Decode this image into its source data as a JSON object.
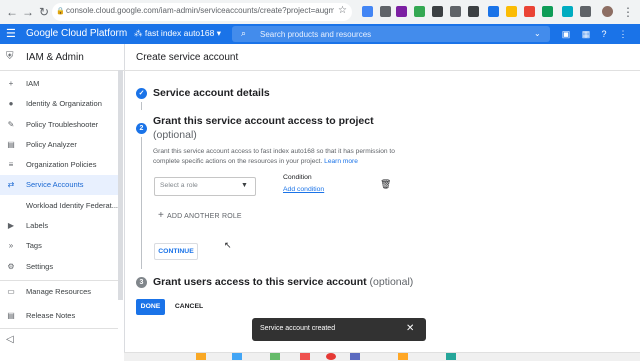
{
  "browser": {
    "url": "console.cloud.google.com/iam-admin/serviceaccounts/create?project=augmented-..."
  },
  "header": {
    "brand": "Google Cloud Platform",
    "project": "fast index auto168",
    "search_placeholder": "Search products and resources"
  },
  "sidebar": {
    "title": "IAM & Admin",
    "items": [
      {
        "label": "IAM",
        "icon": "person-add-icon"
      },
      {
        "label": "Identity & Organization",
        "icon": "account-circle-icon"
      },
      {
        "label": "Policy Troubleshooter",
        "icon": "wrench-icon"
      },
      {
        "label": "Policy Analyzer",
        "icon": "document-search-icon"
      },
      {
        "label": "Organization Policies",
        "icon": "list-icon"
      },
      {
        "label": "Service Accounts",
        "icon": "service-account-icon"
      },
      {
        "label": "Workload Identity Federat...",
        "icon": ""
      },
      {
        "label": "Labels",
        "icon": "label-icon"
      },
      {
        "label": "Tags",
        "icon": "tag-icon"
      },
      {
        "label": "Settings",
        "icon": "gear-icon"
      },
      {
        "label": "Manage Resources",
        "icon": "folder-icon"
      },
      {
        "label": "Release Notes",
        "icon": "notes-icon"
      }
    ]
  },
  "main": {
    "title": "Create service account",
    "step1": {
      "title": "Service account details"
    },
    "step2": {
      "number": "2",
      "title": "Grant this service account access to project",
      "optional": "(optional)",
      "description": "Grant this service account access to fast index auto168 so that it has permission to complete specific actions on the resources in your project.",
      "learn_more": "Learn more",
      "role_placeholder": "Select a role",
      "condition_label": "Condition",
      "add_condition": "Add condition",
      "add_another_role": "ADD ANOTHER ROLE",
      "continue_label": "CONTINUE"
    },
    "step3": {
      "number": "3",
      "title": "Grant users access to this service account",
      "optional": "(optional)"
    },
    "done_label": "DONE",
    "cancel_label": "CANCEL"
  },
  "toast": {
    "message": "Service account created"
  },
  "colors": {
    "accent": "#1a73e8",
    "active_bg": "#e8f0fe",
    "toast_bg": "#323232"
  }
}
